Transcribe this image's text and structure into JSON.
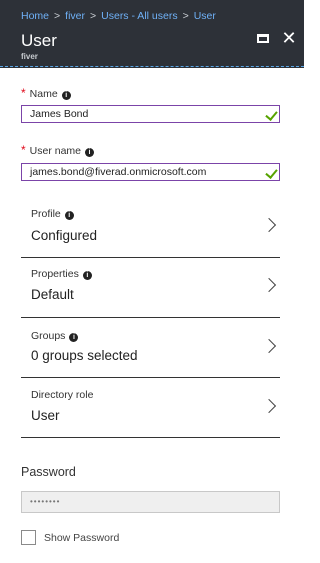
{
  "breadcrumb": [
    "Home",
    "fiver",
    "Users - All users",
    "User"
  ],
  "header": {
    "title": "User",
    "subtitle": "fiver"
  },
  "fields": {
    "name": {
      "label": "Name",
      "value": "James Bond"
    },
    "username": {
      "label": "User name",
      "value": "james.bond@fiverad.onmicrosoft.com"
    }
  },
  "nav_items": [
    {
      "label": "Profile",
      "value": "Configured"
    },
    {
      "label": "Properties",
      "value": "Default"
    },
    {
      "label": "Groups",
      "value": "0 groups selected"
    },
    {
      "label": "Directory role",
      "value": "User"
    }
  ],
  "password": {
    "label": "Password",
    "masked_value": "••••••••",
    "show_label": "Show Password"
  },
  "colors": {
    "header_bg": "#2d3138",
    "breadcrumb_link": "#6fb1f7",
    "valid_check": "#57a300",
    "input_border": "#7b44a8",
    "required": "#e00b1c"
  }
}
